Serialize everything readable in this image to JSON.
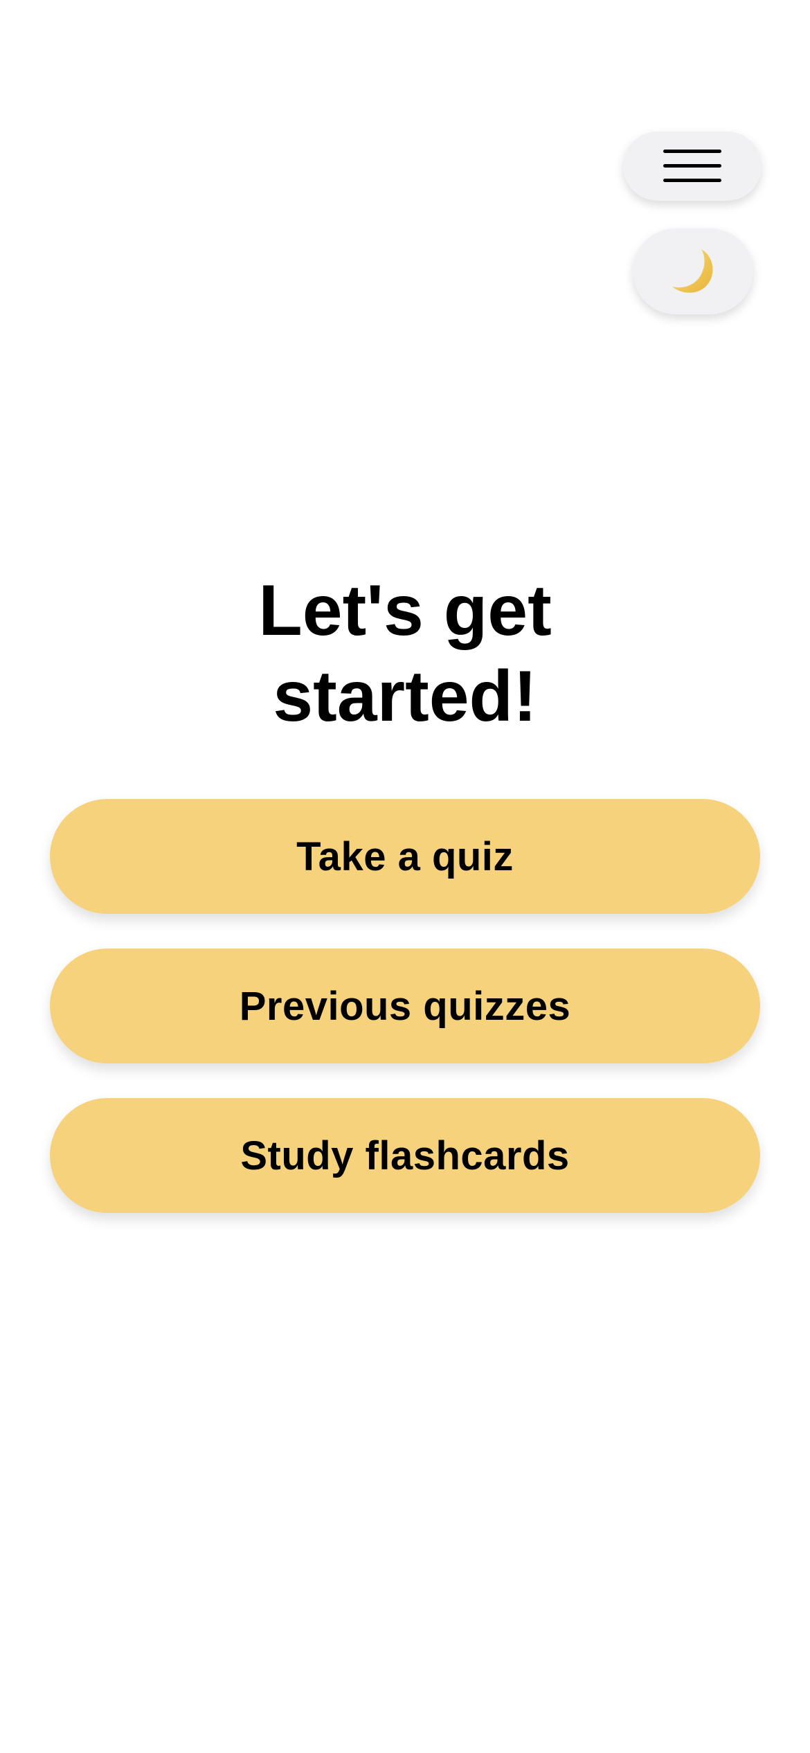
{
  "header": {
    "menu_icon": "hamburger-menu-icon",
    "theme_icon": "crescent-moon-icon"
  },
  "main": {
    "title_line_1": "Let's get",
    "title_line_2": "started!",
    "buttons": [
      {
        "label": "Take a quiz"
      },
      {
        "label": "Previous quizzes"
      },
      {
        "label": "Study flashcards"
      }
    ]
  },
  "colors": {
    "button_background": "#f7d27c",
    "icon_button_background": "#f1f1f4",
    "moon": "#f5c84c"
  }
}
